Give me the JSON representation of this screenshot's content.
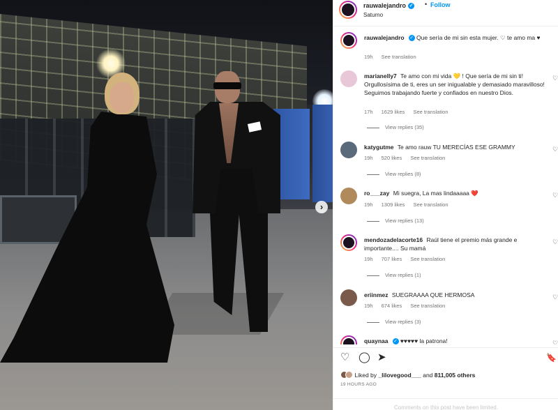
{
  "post": {
    "username": "rauwalejandro",
    "follow_label": "Follow",
    "separator": "•",
    "location": "Saturno",
    "verified_glyph": "✓"
  },
  "photo": {
    "next_arrow": "›"
  },
  "caption": {
    "username": "rauwalejandro",
    "text": "Que sería de mi sin esta mujer. ♡ te amo ma ♥",
    "time": "19h",
    "see_translation": "See translation"
  },
  "comments": [
    {
      "username": "marianelly7",
      "text": "Te amo con mi vida 💛 ! Que sería de mi sin ti! Orgullosísima de ti, eres un ser inigualable y demasiado maravilloso! Seguimos trabajando fuerte y confiados en nuestro Dios.",
      "time": "17h",
      "likes": "1629 likes",
      "translation": "See translation",
      "replies": "View replies (35)",
      "avatar_color": "#e8c7d8"
    },
    {
      "username": "katygutme",
      "text": "Te amo rauw TU MERECÍAS ESE GRAMMY",
      "time": "19h",
      "likes": "520 likes",
      "translation": "See translation",
      "replies": "View replies (8)",
      "avatar_color": "#5a6a7a"
    },
    {
      "username": "ro___zay",
      "text": "Mi suegra, La mas lindaaaaa ❤️",
      "time": "19h",
      "likes": "1309 likes",
      "translation": "See translation",
      "replies": "View replies (13)",
      "avatar_color": "#b08a5a"
    },
    {
      "username": "mendozadelacorte16",
      "text": "Raúl tiene el premio más grande e importante.... Su mamá",
      "time": "19h",
      "likes": "707 likes",
      "translation": "See translation",
      "replies": "View replies (1)",
      "avatar_color": "#2a1a2a"
    },
    {
      "username": "eriinmez",
      "text": "SUEGRAAAA QUE HERMOSA",
      "time": "19h",
      "likes": "674 likes",
      "translation": "See translation",
      "replies": "View replies (3)",
      "avatar_color": "#7a5a4a"
    },
    {
      "username": "quaynaa",
      "text": "♥♥♥♥♥ la patrona!",
      "time": "",
      "likes": "",
      "translation": "",
      "replies": "",
      "avatar_color": "#2a1a2a"
    }
  ],
  "comment_like_glyph": "♡",
  "actions": {
    "like_glyph": "♡",
    "comment_glyph": "◯",
    "share_glyph": "➤",
    "save_glyph": "🔖"
  },
  "likes": {
    "prefix": "Liked by",
    "user": "_lilovegood___",
    "and": "and",
    "count": "811,005 others"
  },
  "posted_time": "19 HOURS AGO",
  "limited_notice": "Comments on this post have been limited."
}
